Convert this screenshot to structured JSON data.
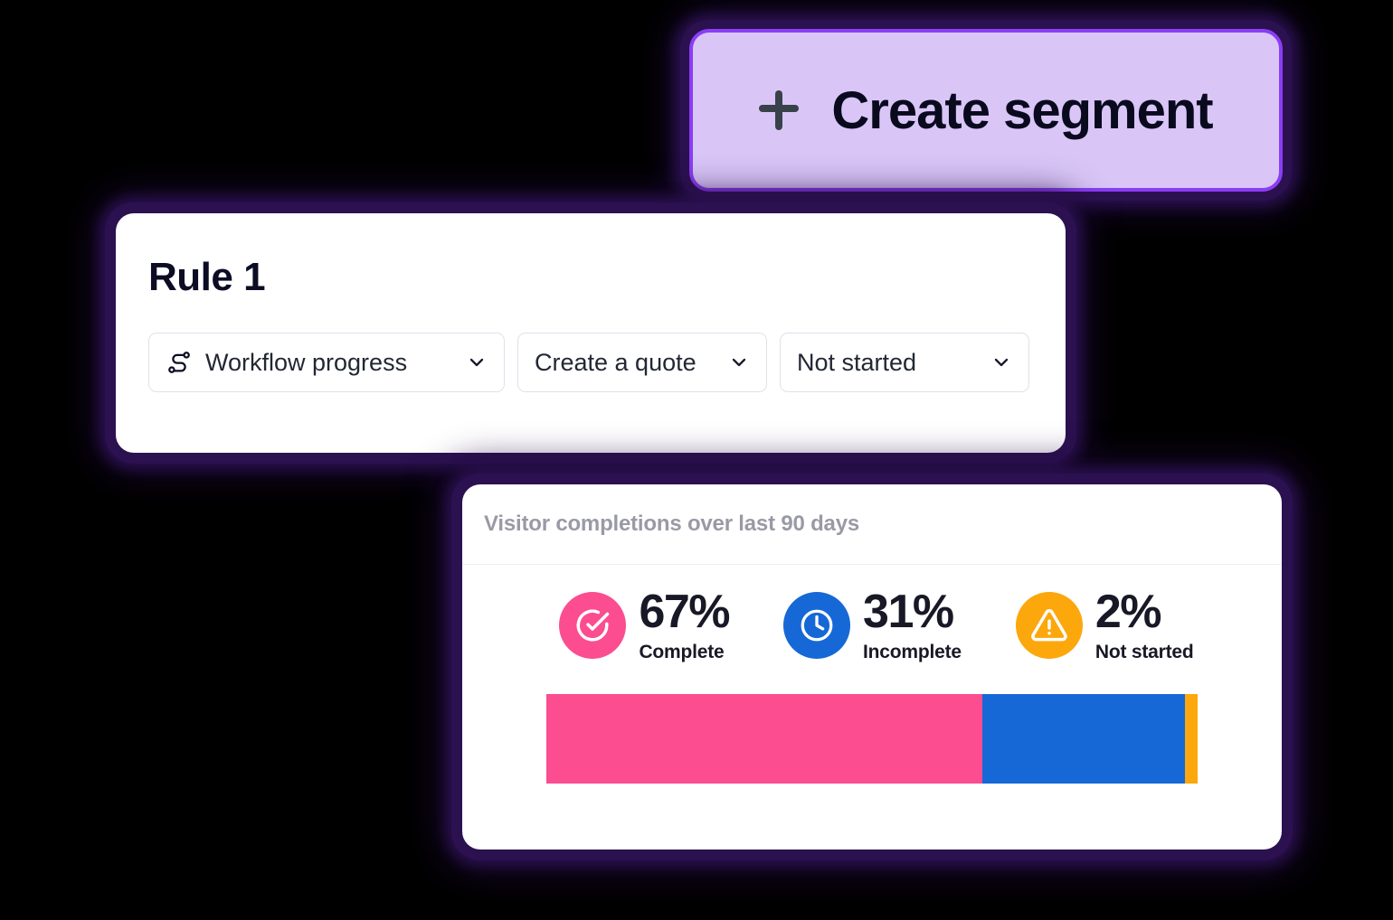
{
  "create_button": {
    "label": "Create segment",
    "icon": "plus-icon",
    "fill_color": "#D9C6F7",
    "border_color": "#8B3DF5"
  },
  "rule_card": {
    "title": "Rule 1",
    "selects": [
      {
        "icon": "route-icon",
        "value": "Workflow progress",
        "chevron": "chevron-down-icon"
      },
      {
        "icon": null,
        "value": "Create a quote",
        "chevron": "chevron-down-icon"
      },
      {
        "icon": null,
        "value": "Not started",
        "chevron": "chevron-down-icon"
      }
    ]
  },
  "chart_card": {
    "header_title": "Visitor completions over last 90 days",
    "stats": [
      {
        "icon": "check-circle-icon",
        "value": "67%",
        "label": "Complete",
        "color": "#FB4D90"
      },
      {
        "icon": "clock-icon",
        "value": "31%",
        "label": "Incomplete",
        "color": "#1668D6"
      },
      {
        "icon": "warning-triangle-icon",
        "value": "2%",
        "label": "Not started",
        "color": "#FCA70B"
      }
    ]
  },
  "chart_data": {
    "type": "bar",
    "title": "Visitor completions over last 90 days",
    "orientation": "horizontal-stacked",
    "categories": [
      "Complete",
      "Incomplete",
      "Not started"
    ],
    "values": [
      67,
      31,
      2
    ],
    "value_labels": [
      "67%",
      "31%",
      "2%"
    ],
    "colors": [
      "#FB4D90",
      "#1668D6",
      "#FCA70B"
    ],
    "units": "percent",
    "total": 100,
    "xlabel": "",
    "ylabel": "",
    "ylim": [
      0,
      100
    ],
    "grid": false,
    "legend": "above-bar"
  },
  "theme": {
    "background": "#000000",
    "glow_color": "#2B1150",
    "card_background": "#FFFFFF"
  }
}
